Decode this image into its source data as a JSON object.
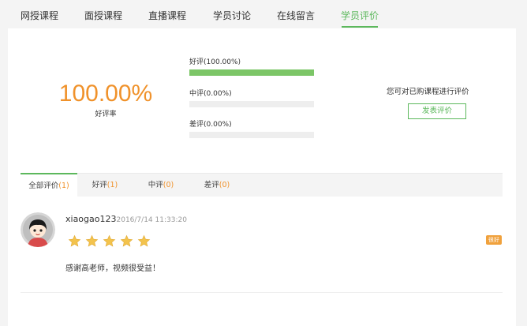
{
  "top_tabs": [
    {
      "label": "网授课程"
    },
    {
      "label": "面授课程"
    },
    {
      "label": "直播课程"
    },
    {
      "label": "学员讨论"
    },
    {
      "label": "在线留言"
    },
    {
      "label": "学员评价"
    }
  ],
  "active_top_tab": 5,
  "summary": {
    "rate": "100.00%",
    "rate_label": "好评率"
  },
  "distribution": [
    {
      "label": "好评(100.00%)",
      "fraction": 1.0
    },
    {
      "label": "中评(0.00%)",
      "fraction": 0.0
    },
    {
      "label": "差评(0.00%)",
      "fraction": 0.0
    }
  ],
  "prompt": {
    "text": "您可对已购课程进行评价",
    "button": "发表评价"
  },
  "filters": [
    {
      "label": "全部评价",
      "count": "(1)"
    },
    {
      "label": "好评",
      "count": "(1)"
    },
    {
      "label": "中评",
      "count": "(0)"
    },
    {
      "label": "差评",
      "count": "(0)"
    }
  ],
  "review": {
    "username": "xiaogao123",
    "date": "2016/7/14 11:33:20",
    "stars": 5,
    "badge": "很好",
    "content": "感谢高老师，视频很受益！"
  },
  "colors": {
    "accent_green": "#5cb85c",
    "bar_green": "#7cc667",
    "orange": "#f0922b"
  },
  "icons": [
    "avatar",
    "star-icon"
  ]
}
